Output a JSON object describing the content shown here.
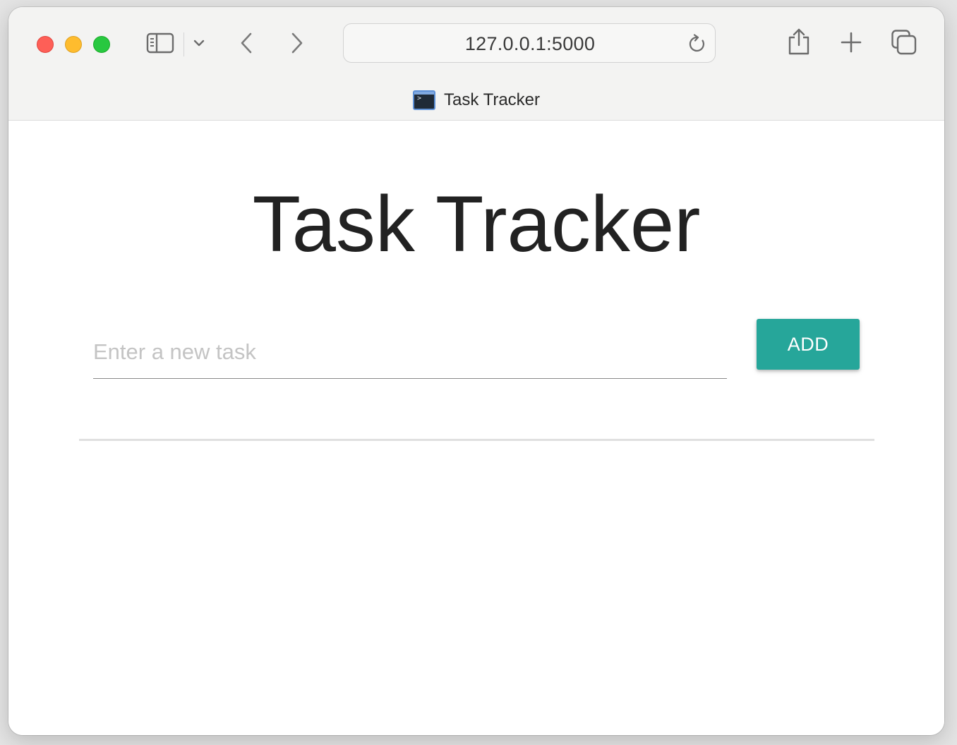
{
  "browser": {
    "address": "127.0.0.1:5000",
    "tab_title": "Task Tracker",
    "icons": {
      "sidebar": "sidebar-icon",
      "dropdown": "chevron-down-icon",
      "back": "chevron-left-icon",
      "forward": "chevron-right-icon",
      "reload": "reload-icon",
      "share": "share-icon",
      "new_tab": "plus-icon",
      "tabs_overview": "tabs-overview-icon"
    }
  },
  "page": {
    "title": "Task Tracker",
    "input_placeholder": "Enter a new task",
    "input_value": "",
    "add_button_label": "ADD",
    "accent_color": "#26a69a"
  }
}
